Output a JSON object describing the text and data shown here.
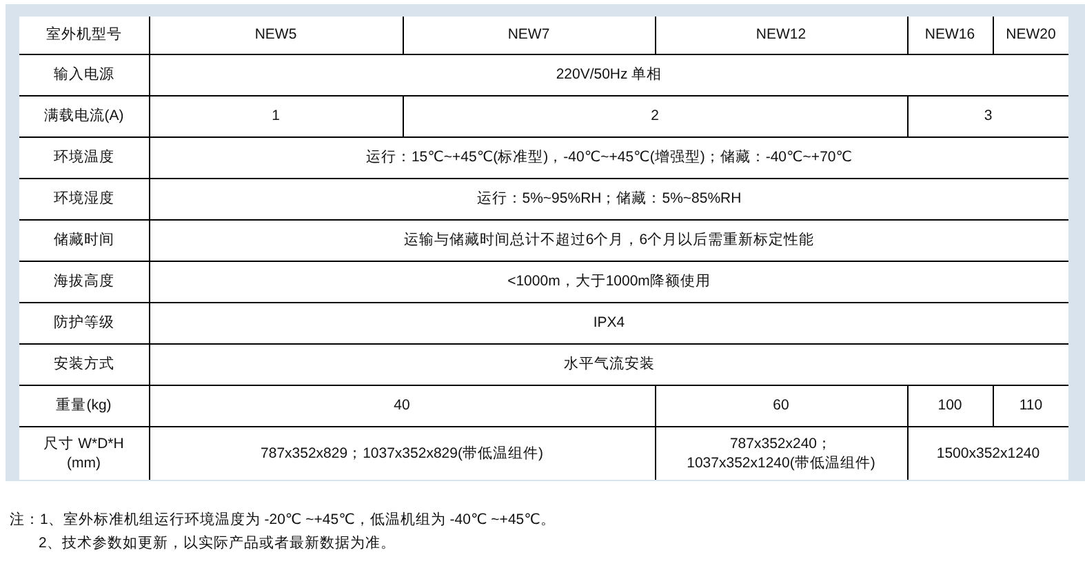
{
  "table": {
    "header": {
      "label": "室外机型号",
      "models": [
        "NEW5",
        "NEW7",
        "NEW12",
        "NEW16",
        "NEW20"
      ]
    },
    "rows": [
      {
        "label": [
          "输入电源"
        ],
        "cells": [
          {
            "lines": [
              "220V/50Hz 单相"
            ],
            "colspan": 5
          }
        ]
      },
      {
        "label": [
          "满载电流(A)"
        ],
        "cells": [
          {
            "lines": [
              "1"
            ]
          },
          {
            "lines": [
              "2"
            ],
            "colspan": 2
          },
          {
            "lines": [
              "3"
            ],
            "colspan": 2
          }
        ]
      },
      {
        "label": [
          "环境温度"
        ],
        "cells": [
          {
            "lines": [
              "运行：15℃~+45℃(标准型)，-40℃~+45℃(增强型)；储藏：-40℃~+70℃"
            ],
            "colspan": 5
          }
        ]
      },
      {
        "label": [
          "环境湿度"
        ],
        "cells": [
          {
            "lines": [
              "运行：5%~95%RH；储藏：5%~85%RH"
            ],
            "colspan": 5
          }
        ]
      },
      {
        "label": [
          "储藏时间"
        ],
        "cells": [
          {
            "lines": [
              "运输与储藏时间总计不超过6个月，6个月以后需重新标定性能"
            ],
            "colspan": 5
          }
        ]
      },
      {
        "label": [
          "海拔高度"
        ],
        "cells": [
          {
            "lines": [
              "<1000m，大于1000m降额使用"
            ],
            "colspan": 5
          }
        ]
      },
      {
        "label": [
          "防护等级"
        ],
        "cells": [
          {
            "lines": [
              "IPX4"
            ],
            "colspan": 5
          }
        ]
      },
      {
        "label": [
          "安装方式"
        ],
        "cells": [
          {
            "lines": [
              "水平气流安装"
            ],
            "colspan": 5
          }
        ]
      },
      {
        "label": [
          "重量(kg)"
        ],
        "cells": [
          {
            "lines": [
              "40"
            ],
            "colspan": 2
          },
          {
            "lines": [
              "60"
            ]
          },
          {
            "lines": [
              "100"
            ]
          },
          {
            "lines": [
              "110"
            ]
          }
        ]
      },
      {
        "label": [
          "尺寸 W*D*H",
          "(mm)"
        ],
        "cells": [
          {
            "lines": [
              "787x352x829；1037x352x829(带低温组件)"
            ],
            "colspan": 2
          },
          {
            "lines": [
              "787x352x240；",
              "1037x352x1240(带低温组件)"
            ]
          },
          {
            "lines": [
              "1500x352x1240"
            ],
            "colspan": 2
          }
        ]
      }
    ]
  },
  "notes": [
    "注：1、室外标准机组运行环境温度为 -20℃ ~+45℃，低温机组为 -40℃ ~+45℃。",
    "2、技术参数如更新，以实际产品或者最新数据为准。"
  ]
}
